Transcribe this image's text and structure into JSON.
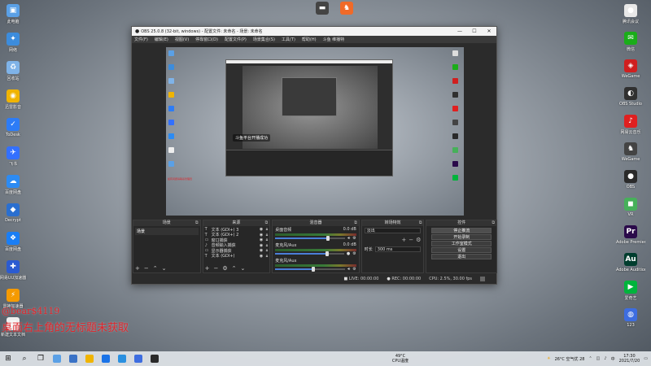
{
  "desktop": {
    "left_icons": [
      {
        "label": "此电脑",
        "color": "#5aa0e6",
        "glyph": "▣"
      },
      {
        "label": "网络",
        "color": "#3c8cdc",
        "glyph": "✦"
      },
      {
        "label": "回收站",
        "color": "#7fb3e8",
        "glyph": "♻"
      },
      {
        "label": "迅雷影音",
        "color": "#f0b400",
        "glyph": "◉"
      },
      {
        "label": "ToDesk",
        "color": "#2d7cf6",
        "glyph": "✓"
      },
      {
        "label": "飞书",
        "color": "#3370ff",
        "glyph": "✈"
      },
      {
        "label": "百度网盘",
        "color": "#2c8bf3",
        "glyph": "☁"
      },
      {
        "label": "Decrypt",
        "color": "#2a6fd0",
        "glyph": "◆"
      },
      {
        "label": "百度网盘",
        "color": "#1a7ef5",
        "glyph": "❖"
      },
      {
        "label": "网易UU加速器",
        "color": "#2b5bd1",
        "glyph": "✚"
      },
      {
        "label": "雷神加速器",
        "color": "#f59a00",
        "glyph": "⚡"
      },
      {
        "label": "新建文本文档",
        "color": "#eeeeee",
        "glyph": "▤"
      }
    ],
    "right_icons": [
      {
        "label": "腾讯会议",
        "color": "#e8e8e8",
        "glyph": "●"
      },
      {
        "label": "微信",
        "color": "#1aad19",
        "glyph": "✉"
      },
      {
        "label": "WeGame",
        "color": "#d01f1f",
        "glyph": "◈"
      },
      {
        "label": "OBS Studio",
        "color": "#303030",
        "glyph": "◐"
      },
      {
        "label": "网易云音乐",
        "color": "#e02020",
        "glyph": "♪"
      },
      {
        "label": "WeGame",
        "color": "#444444",
        "glyph": "♞"
      },
      {
        "label": "OBS",
        "color": "#2a2a2a",
        "glyph": "●"
      },
      {
        "label": "VR",
        "color": "#47b05a",
        "glyph": "◼"
      },
      {
        "label": "Adobe Premiere",
        "color": "#2a0a4a",
        "glyph": "Pr"
      },
      {
        "label": "Adobe Audition",
        "color": "#003d2e",
        "glyph": "Au"
      },
      {
        "label": "爱奇艺",
        "color": "#00b43c",
        "glyph": "▶"
      },
      {
        "label": "123",
        "color": "#3d6de0",
        "glyph": "◍"
      }
    ],
    "top_icons": [
      {
        "label": "",
        "color": "#444",
        "glyph": "▬"
      },
      {
        "label": "",
        "color": "#f06a28",
        "glyph": "♞"
      }
    ],
    "overlay_line1": "@bear$4119",
    "overlay_line2": "桌面右上角的无标题未获取"
  },
  "obs": {
    "title": "OBS 25.0.8 (32-bit, windows) - 配置文件: 未命名 - 场景: 未命名",
    "menu": [
      "文件(F)",
      "编辑(E)",
      "视图(V)",
      "停靠窗口(D)",
      "配置文件(P)",
      "场景集合(S)",
      "工具(T)",
      "帮助(H)",
      "斗鱼 维播特"
    ],
    "preview_toast": "斗鱼平台开播成功",
    "preview_note": "如有问题请联系管理员",
    "docks": {
      "scenes_title": "场景",
      "scene_items": [
        "场景"
      ],
      "sources_title": "来源",
      "source_items": [
        {
          "icon": "T",
          "label": "文本 (GDI+) 3"
        },
        {
          "icon": "T",
          "label": "文本 (GDI+) 2"
        },
        {
          "icon": "▭",
          "label": "窗口捕获"
        },
        {
          "icon": "♪",
          "label": "音频输入捕获"
        },
        {
          "icon": "▭",
          "label": "显示器捕获"
        },
        {
          "icon": "T",
          "label": "文本 (GDI+)"
        }
      ],
      "mixer_title": "混音器",
      "mixer_channels": [
        {
          "name": "桌面音频",
          "db": "0.0 dB",
          "level": 0.75
        },
        {
          "name": "麦克风/Aux",
          "db": "0.0 dB",
          "level": 0.75
        },
        {
          "name": "麦克风/Aux",
          "db": "",
          "level": 0.55
        }
      ],
      "transitions_title": "转场特效",
      "transition_value": "淡出",
      "duration_label": "时长",
      "duration_value": "300 ms",
      "controls_title": "控件",
      "controls": [
        "停止推流",
        "开始录制",
        "工作室模式",
        "设置",
        "退出"
      ]
    },
    "status": {
      "live": "LIVE: 00:00:00",
      "rec": "REC: 00:00:00",
      "cpu": "CPU: 2.5%, 30.00 fps"
    }
  },
  "taskbar": {
    "start_icon": "⊞",
    "search_icon": "⌕",
    "apps": [
      {
        "color": "#5aa0e6"
      },
      {
        "color": "#3a72c6"
      },
      {
        "color": "#f0b400"
      },
      {
        "color": "#1a73e8"
      },
      {
        "color": "#2a90e0"
      },
      {
        "color": "#3d6de0"
      },
      {
        "color": "#2a2a2a"
      }
    ],
    "cpu_temp": "49°C",
    "cpu_label": "CPU温度",
    "weather": "26°C 空气优 28",
    "time": "17:30",
    "date": "2021/7/20"
  }
}
